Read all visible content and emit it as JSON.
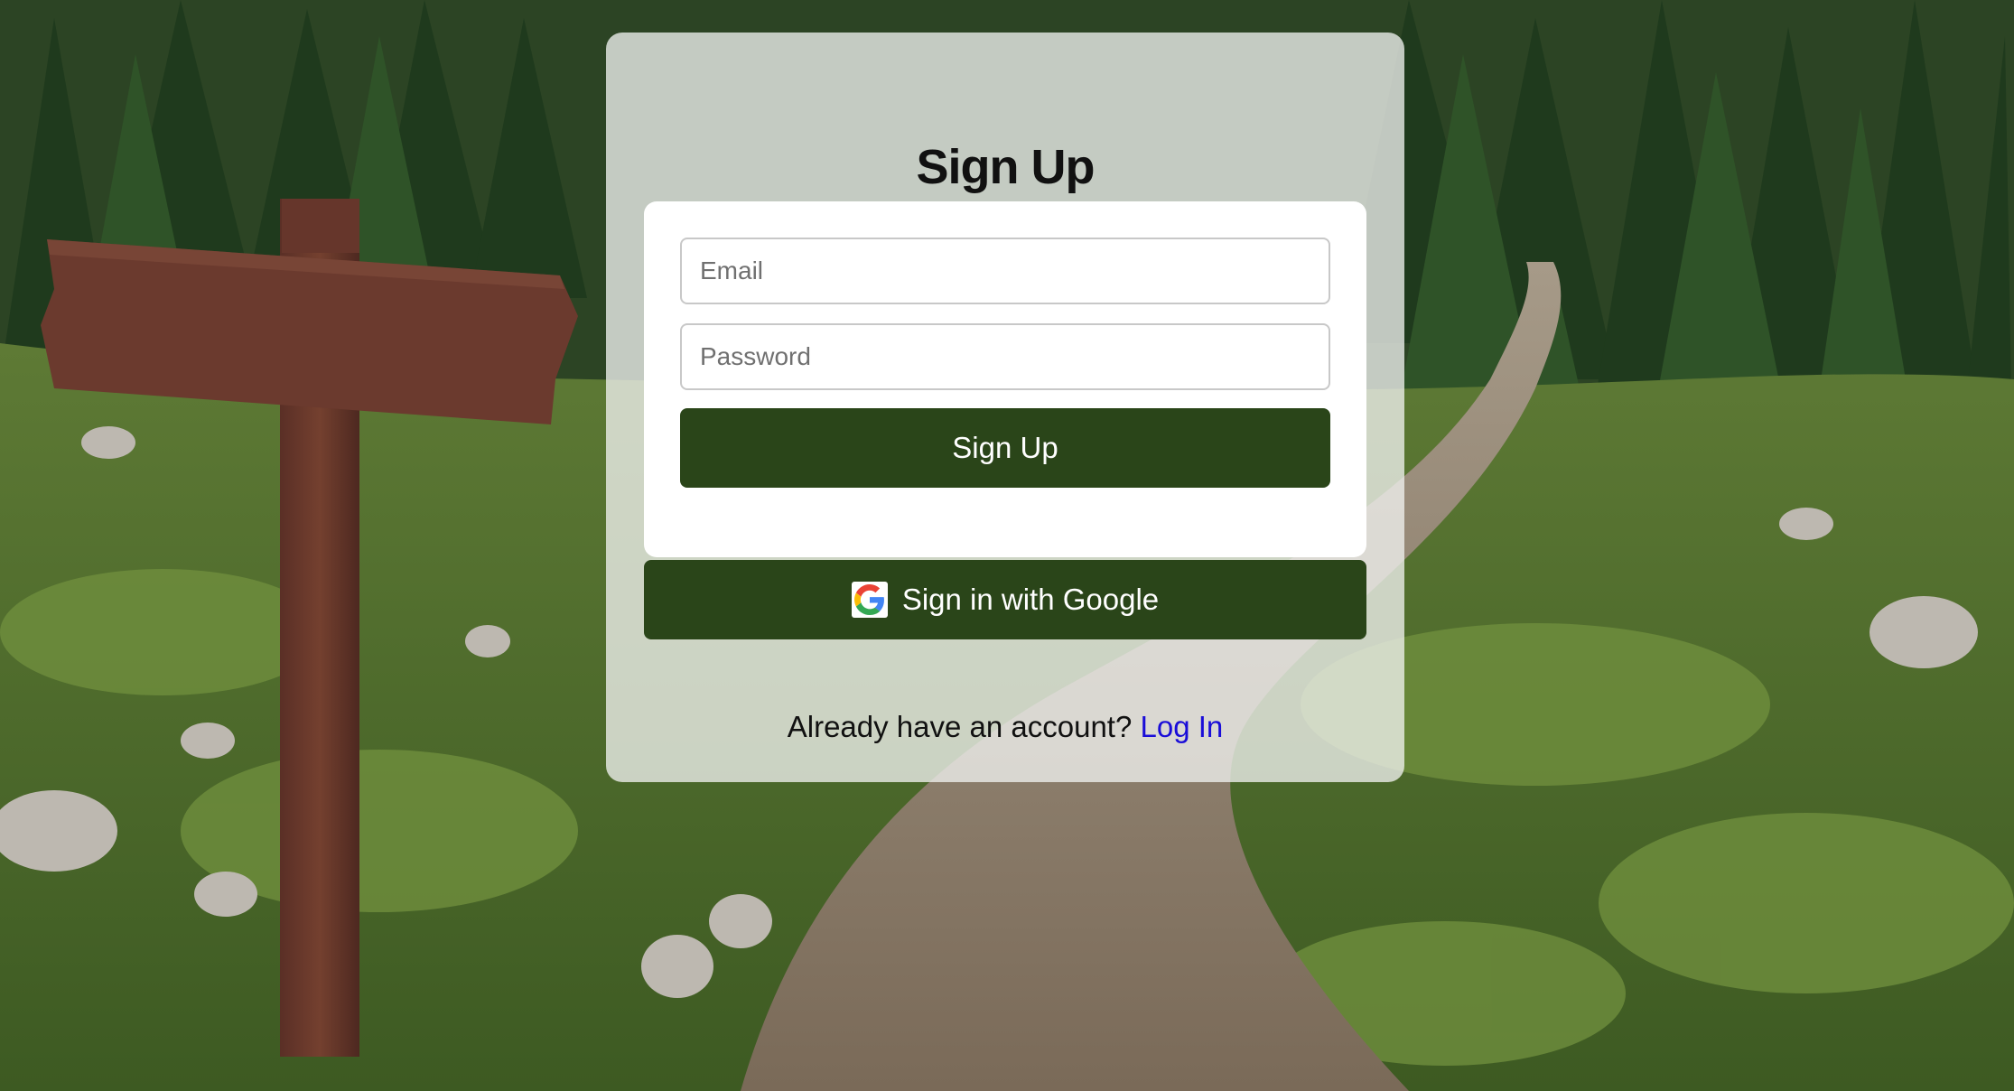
{
  "page": {
    "title": "Sign Up"
  },
  "form": {
    "email_placeholder": "Email",
    "email_value": "",
    "password_placeholder": "Password",
    "password_value": "",
    "submit_label": "Sign Up"
  },
  "google": {
    "label": "Sign in with Google",
    "icon": "google-g-icon"
  },
  "footer": {
    "prompt": "Already have an account?",
    "login_link": "Log In"
  },
  "background": {
    "image": "forest-trail-with-wooden-signpost"
  },
  "colors": {
    "button_bg": "#2a4519",
    "button_text": "#ffffff",
    "link": "#1a0dd8",
    "card_bg": "rgba(240,241,238,0.78)"
  }
}
